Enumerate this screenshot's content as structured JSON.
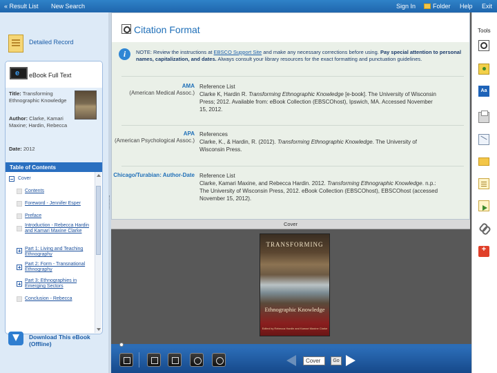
{
  "topbar": {
    "result_list": "« Result List",
    "new_search": "New Search",
    "sign_in": "Sign In",
    "folder": "Folder",
    "help": "Help",
    "exit": "Exit"
  },
  "left": {
    "detailed_record": "Detailed Record",
    "ebook_full_text": "eBook Full Text",
    "meta": {
      "title_label": "Title:",
      "title_value": "Transforming Ethnographic Knowledge",
      "author_label": "Author:",
      "author_value": "Clarke, Kamari Maxine; Hardin, Rebecca",
      "date_label": "Date:",
      "date_value": "2012"
    },
    "toc_header": "Table of Contents",
    "toc": [
      {
        "label": "Cover",
        "type": "minus"
      },
      {
        "label": "Contents",
        "type": "box"
      },
      {
        "label": "Foreword - Jennifer Esper",
        "type": "box"
      },
      {
        "label": "Preface",
        "type": "box"
      },
      {
        "label": "Introduction - Rebecca Hardin and Kamari Maxine Clarke",
        "type": "box"
      },
      {
        "label": "Part 1: Living and Teaching Ethnography",
        "type": "plus"
      },
      {
        "label": "Part 2: Form - Transnational Ethnography",
        "type": "plus"
      },
      {
        "label": "Part 3: Ethnographies in Emerging Sectors",
        "type": "plus"
      },
      {
        "label": "Conclusion - Rebecca",
        "type": "box"
      }
    ],
    "download": "Download This eBook (Offline)"
  },
  "citation": {
    "title": "Citation Format",
    "note_plain_1": "NOTE: Review the instructions at ",
    "note_link": "EBSCO Support Site",
    "note_plain_2": " and make any necessary corrections before using. ",
    "note_bold": "Pay special attention to personal names, capitalization, and dates.",
    "note_plain_3": " Always consult your library resources for the exact formatting and punctuation guidelines.",
    "styles": [
      {
        "name": "AMA",
        "full": "(American Medical Assoc.)",
        "heading": "Reference List",
        "pre": "Clarke K, Hardin R. ",
        "italic": "Transforming Ethnographic Knowledge",
        "post": " [e-book]. The University of Wisconsin Press; 2012. Available from: eBook Collection (EBSCOhost), Ipswich, MA. Accessed November 15, 2012."
      },
      {
        "name": "APA",
        "full": "(American Psychological Assoc.)",
        "heading": "References",
        "pre": "Clarke, K., & Hardin, R. (2012). ",
        "italic": "Transforming Ethnographic Knowledge",
        "post": ". The University of Wisconsin Press."
      },
      {
        "name": "Chicago/Turabian: Author-Date",
        "full": "",
        "heading": "Reference List",
        "pre": "Clarke, Kamari Maxine, and Rebecca Hardin. 2012. ",
        "italic": "Transforming Ethnographic Knowledge",
        "post": ". n.p.: The University of Wisconsin Press, 2012. eBook Collection (EBSCOhost), EBSCOhost (accessed November 15, 2012)."
      }
    ]
  },
  "viewer": {
    "cover_label": "Cover",
    "book_title_1": "TRANSFORMING",
    "book_title_2": "Ethnographic Knowledge",
    "book_sub": "Edited by Rebecca Hardin and Kamari Maxine Clarke",
    "page_value": "Cover",
    "go_label": "Go"
  },
  "tools": {
    "title": "Tools",
    "items": [
      "search-within",
      "add-to-folder",
      "dictionary",
      "print",
      "email",
      "save",
      "cite",
      "export",
      "permalink",
      "google-plus"
    ]
  },
  "colors": {
    "accent": "#2f82c8",
    "link": "#1f6fb8",
    "viewer_bg": "#585858"
  }
}
